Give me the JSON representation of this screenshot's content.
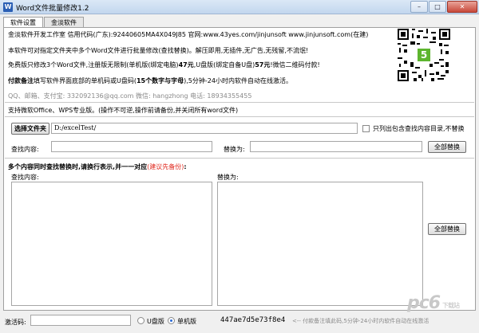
{
  "window": {
    "title": "Word文件批量修改1.2",
    "icon_letter": "W",
    "min_label": "–",
    "max_label": "□",
    "close_label": "✕"
  },
  "tabs": [
    "软件设置",
    "金淡软件"
  ],
  "info": {
    "line1": "金淡软件开发工作室 信用代码(广东):92440605MA4X049J85 官网:www.43yes.com/jinjunsoft  www.jinjunsoft.com(在建)",
    "line2": "本软件可对指定文件夹中多个Word文件进行批量修改(查找替换)。解压即用,无插件,无广告,无残留,不流氓!",
    "line3_a": "免费版只修改3个Word文件,注册版无限制(单机版(绑定电脑)",
    "line3_b": "47元",
    "line3_c": ",U盘版(绑定自备U盘)",
    "line3_d": "57元",
    "line3_e": "!微信二维码付款!",
    "line4_a": "付款备注",
    "line4_b": "填写软件界面底部的单机码或U盘码(",
    "line4_c": "15个数字与字母",
    "line4_d": "),5分钟-24小时内软件自动在线激活。",
    "contact": "QQ、邮箱、支付宝: 332092136@qq.com       微信: hangzhong      电话: 18934355455",
    "support": "支持微软Office、WPS专业版。(操作不可逆,操作前请备份,并关闭所有word文件)"
  },
  "qr": {
    "badge": "5"
  },
  "folder": {
    "button": "选择文件夹",
    "path": "D:/excelTest/",
    "subdir_label": "只列出包含查找内容目录,不替换"
  },
  "single": {
    "find_label": "查找内容:",
    "find_value": "",
    "replace_label": "替换为:",
    "replace_value": "",
    "replace_all": "全部替换"
  },
  "multi": {
    "heading_a": "多个内容同时查找替换时,请换行表示,并一一对应",
    "heading_b": "(建议先备份)",
    "heading_c": ":",
    "find_label": "查找内容:",
    "replace_label": "替换为:",
    "replace_all": "全部替换"
  },
  "status": {
    "code_label": "激活码:",
    "code_value": "",
    "usb_label": "U盘版",
    "pc_label": "单机版",
    "machine_code": "447ae7d5e73f8e4",
    "hint": "<-- 付款备注填此码,5分钟-24小时内软件自动在线激活"
  },
  "watermark": {
    "text": "pc6",
    "sub": "下载站"
  }
}
